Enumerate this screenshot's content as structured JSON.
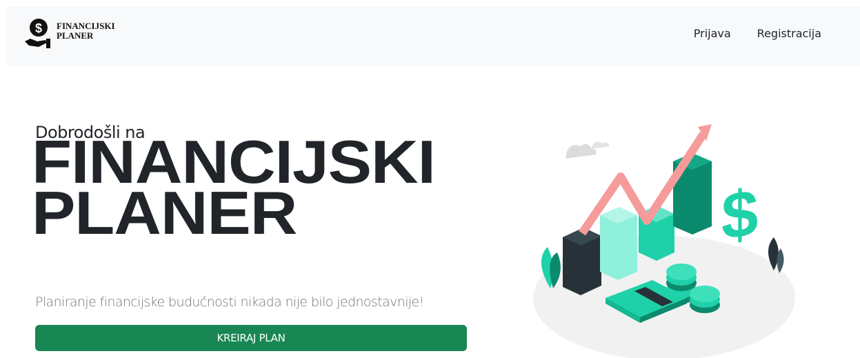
{
  "navbar": {
    "brand_line1": "FINANCIJSKI",
    "brand_line2": "PLANER",
    "brand_icon": "money-hand-icon",
    "links": [
      {
        "label": "Prijava"
      },
      {
        "label": "Registracija"
      }
    ]
  },
  "hero": {
    "intro": "Dobrodošli na",
    "title_line1": "FINANCIJSKI",
    "title_line2": "PLANER",
    "subtitle": "Planiranje financijske budućnosti nikada nije bilo jednostavnije!",
    "cta_label": "KREIRAJ PLAN",
    "illustration": "financial-growth-illustration"
  },
  "colors": {
    "navbar_bg": "#f8f9fa",
    "button": "#198754",
    "teal": "#1fd1a8",
    "dark_teal": "#0b8a6d",
    "salmon_arrow": "#f59b9b",
    "dark_bar": "#263238"
  }
}
